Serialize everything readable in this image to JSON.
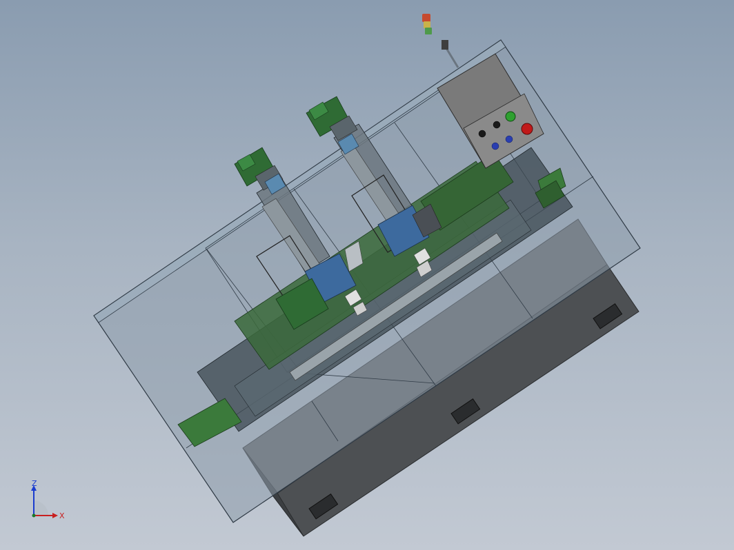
{
  "viewport": {
    "background_top": "#8a9cb0",
    "background_bottom": "#c2c9d3"
  },
  "model": {
    "colors": {
      "enclosure_glass": "#8e9cab",
      "enclosure_edge": "#2f3a45",
      "base_cabinet": "#525558",
      "base_cabinet_dark": "#3d4043",
      "motor_green": "#2f6b34",
      "slider_green": "#3b6a3b",
      "fixture_blue": "#3d6a9e",
      "control_panel": "#7a7a7a",
      "signal_tower_red": "#c64a2f",
      "signal_tower_yellow": "#c9b24a",
      "signal_tower_green": "#4e9a4a"
    },
    "control_panel_buttons": [
      {
        "name": "black-button-1",
        "color": "#1a1a1a"
      },
      {
        "name": "black-button-2",
        "color": "#1a1a1a"
      },
      {
        "name": "green-button",
        "color": "#2fa030"
      },
      {
        "name": "blue-button-1",
        "color": "#2a3eb0"
      },
      {
        "name": "blue-button-2",
        "color": "#2a3eb0"
      },
      {
        "name": "red-button",
        "color": "#c11a1a"
      }
    ]
  },
  "triad": {
    "z_label": "Z",
    "x_label": "X",
    "z_color": "#1a3ccf",
    "x_color": "#c82020"
  }
}
